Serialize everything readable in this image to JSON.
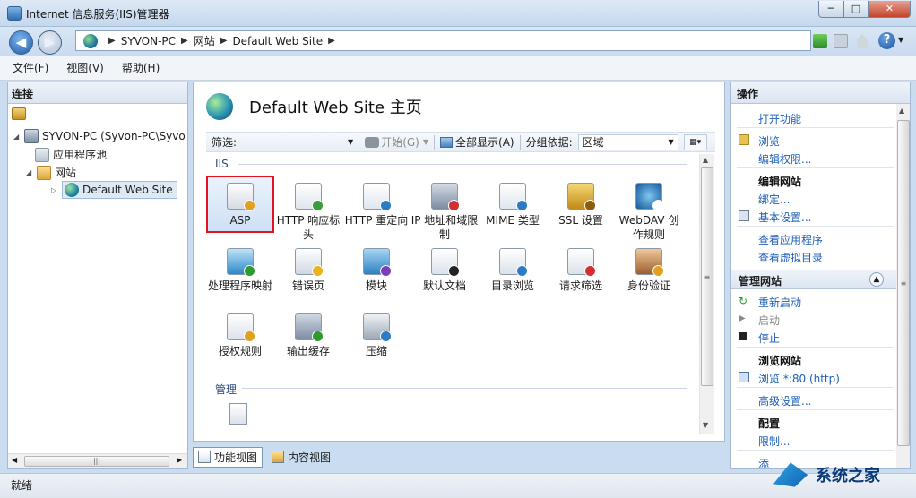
{
  "window": {
    "title": "Internet 信息服务(IIS)管理器",
    "min": "─",
    "max": "□",
    "close": "✕"
  },
  "address": {
    "crumbs": [
      "SYVON-PC",
      "网站",
      "Default Web Site"
    ],
    "sep": "▶"
  },
  "menu": [
    "文件(F)",
    "视图(V)",
    "帮助(H)"
  ],
  "connections": {
    "title": "连接",
    "tree": {
      "server": "SYVON-PC (Syvon-PC\\Syvo",
      "app_pools": "应用程序池",
      "sites": "网站",
      "site": "Default Web Site"
    }
  },
  "page": {
    "title": "Default Web Site 主页",
    "filter_label": "筛选:",
    "start": "开始(G)",
    "show_all": "全部显示(A)",
    "group_by_label": "分组依据:",
    "group_by_value": "区域",
    "groups": {
      "iis": "IIS",
      "manage": "管理"
    },
    "features_row1": [
      "ASP",
      "HTTP 响应标头",
      "HTTP 重定向",
      "IP 地址和域限制",
      "MIME 类型",
      "SSL 设置",
      "WebDAV 创作规则"
    ],
    "features_row2": [
      "处理程序映射",
      "错误页",
      "模块",
      "默认文档",
      "目录浏览",
      "请求筛选",
      "身份验证"
    ],
    "features_row3": [
      "授权规则",
      "输出缓存",
      "压缩"
    ]
  },
  "views": {
    "features": "功能视图",
    "content": "内容视图"
  },
  "actions": {
    "title": "操作",
    "open_feature": "打开功能",
    "explore": "浏览",
    "edit_permissions": "编辑权限...",
    "edit_site": "编辑网站",
    "bindings": "绑定...",
    "basic_settings": "基本设置...",
    "view_apps": "查看应用程序",
    "view_vdirs": "查看虚拟目录",
    "manage_site": "管理网站",
    "restart": "重新启动",
    "start": "启动",
    "stop": "停止",
    "browse_site": "浏览网站",
    "browse_80": "浏览 *:80 (http)",
    "advanced": "高级设置...",
    "configure": "配置",
    "limits": "限制...",
    "cut": "添"
  },
  "status": "就绪",
  "watermark": "系统之家",
  "colors": {
    "accent": "#1e5fb8",
    "selection_border": "#e0141e"
  }
}
